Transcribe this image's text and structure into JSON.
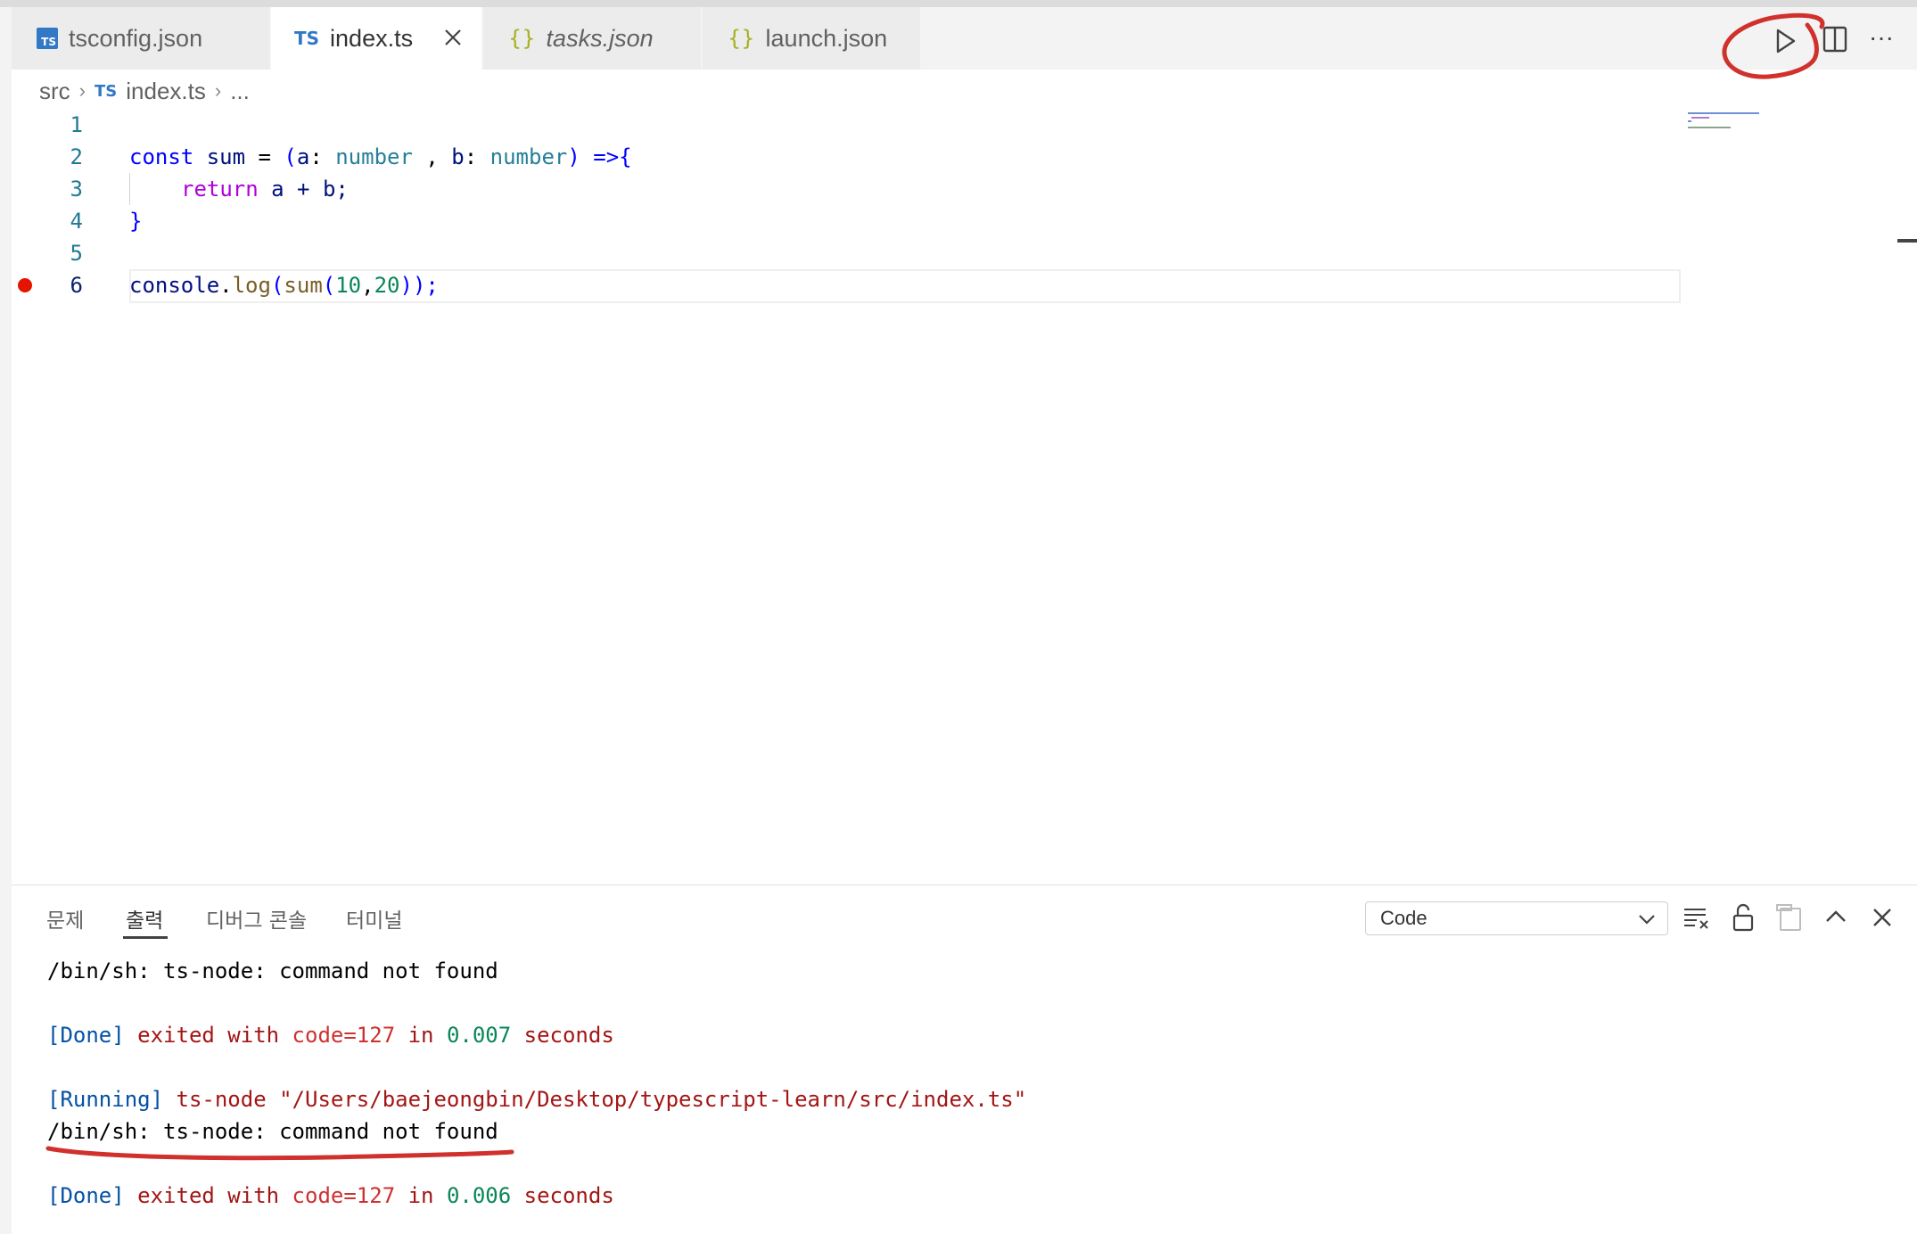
{
  "tabs": [
    {
      "label": "tsconfig.json",
      "icon": "ts-config-icon",
      "italic": false,
      "active": false
    },
    {
      "label": "index.ts",
      "icon": "ts-icon",
      "icon_text": "TS",
      "italic": false,
      "active": true
    },
    {
      "label": "tasks.json",
      "icon": "json-braces-icon",
      "icon_text": "{}",
      "italic": true,
      "active": false
    },
    {
      "label": "launch.json",
      "icon": "json-braces-icon",
      "icon_text": "{}",
      "italic": false,
      "active": false
    }
  ],
  "toolbar": {
    "run": "run-icon",
    "split": "split-editor-icon",
    "more": "more-actions-icon",
    "more_text": "···"
  },
  "breadcrumb": {
    "folder": "src",
    "file_icon": "TS",
    "file": "index.ts",
    "ellipsis": "..."
  },
  "editor": {
    "line_numbers": [
      "1",
      "2",
      "3",
      "4",
      "5",
      "6"
    ],
    "current_line": "6",
    "breakpoint_line": "6",
    "code": {
      "l2": {
        "const": "const",
        "sum": "sum",
        "eq": " = ",
        "p1": "(",
        "a": "a",
        "colon1": ": ",
        "number1": "number",
        "comma": " , ",
        "b": "b",
        "colon2": ": ",
        "number2": "number",
        "p2": ")",
        "arrow": " =>",
        "brace": "{"
      },
      "l3": {
        "return": "return",
        "expr": " a + b;"
      },
      "l4": {
        "brace": "}"
      },
      "l6": {
        "console": "console",
        "dot": ".",
        "log": "log",
        "p1": "(",
        "sum": "sum",
        "p2": "(",
        "n1": "10",
        "comma": ",",
        "n2": "20",
        "close": "));"
      }
    }
  },
  "panel": {
    "tabs": [
      "문제",
      "출력",
      "디버그 콘솔",
      "터미널"
    ],
    "active_tab": "출력",
    "channel": "Code",
    "output": {
      "line1": "/bin/sh: ts-node: command not found",
      "done1": {
        "tag": "[Done]",
        "text1": " exited with ",
        "code": "code=127",
        "in": " in ",
        "time": "0.007",
        "seconds": " seconds"
      },
      "running": {
        "tag": "[Running]",
        "cmd": " ts-node ",
        "path": "\"/Users/baejeongbin/Desktop/typescript-learn/src/index.ts\""
      },
      "line2": "/bin/sh: ts-node: command not found",
      "done2": {
        "tag": "[Done]",
        "text1": " exited with ",
        "code": "code=127",
        "in": " in ",
        "time": "0.006",
        "seconds": " seconds"
      }
    }
  },
  "colors": {
    "keyword": "#0000ff",
    "variable": "#001080",
    "type": "#267f99",
    "control": "#af00db",
    "function": "#795e26",
    "number": "#098658",
    "annotation": "#d0312d",
    "breakpoint": "#e51400"
  }
}
